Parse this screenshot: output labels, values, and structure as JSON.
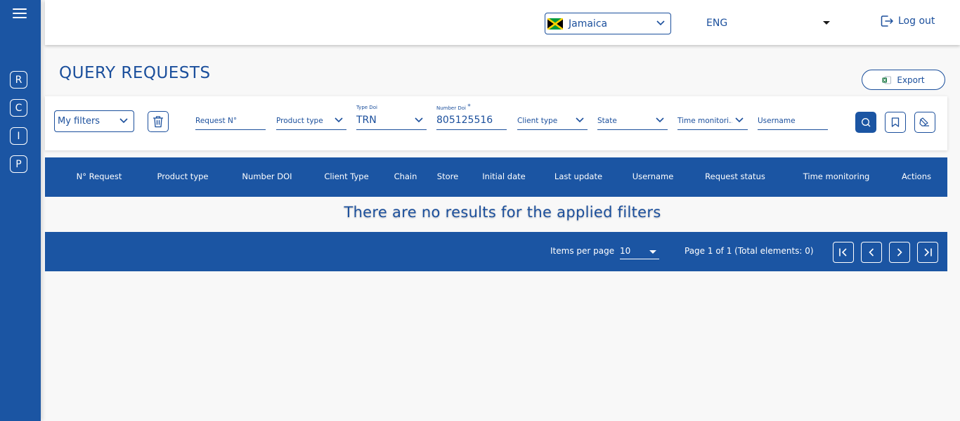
{
  "header": {
    "country": "Jamaica",
    "language": "ENG",
    "logout_label": "Log out"
  },
  "sidebar": {
    "items": [
      {
        "label": "R"
      },
      {
        "label": "C"
      },
      {
        "label": "I"
      },
      {
        "label": "P"
      }
    ]
  },
  "page": {
    "title": "QUERY REQUESTS",
    "export_label": "Export"
  },
  "filters": {
    "my_filters": "My filters",
    "request_no_placeholder": "Request N°",
    "product_type_placeholder": "Product type",
    "type_doi_label": "Type Doi",
    "type_doi_value": "TRN",
    "number_doi_label": "Number Doi",
    "number_doi_required": "*",
    "number_doi_value": "805125516",
    "client_type_placeholder": "Client type",
    "state_placeholder": "State",
    "time_monitoring_placeholder": "Time monitori…",
    "username_placeholder": "Username"
  },
  "table": {
    "columns": [
      "N° Request",
      "Product type",
      "Number DOI",
      "Client Type",
      "Chain",
      "Store",
      "Initial date",
      "Last update",
      "Username",
      "Request status",
      "Time monitoring",
      "Actions"
    ],
    "empty_message": "There are no results for the applied filters"
  },
  "pagination": {
    "items_per_page_label": "Items per page",
    "items_per_page_value": "10",
    "page_info": "Page 1 of 1 (Total elements: 0)"
  },
  "colors": {
    "primary": "#1b55a3",
    "text_primary": "#1b4f9c",
    "background": "#f8f8f8"
  }
}
